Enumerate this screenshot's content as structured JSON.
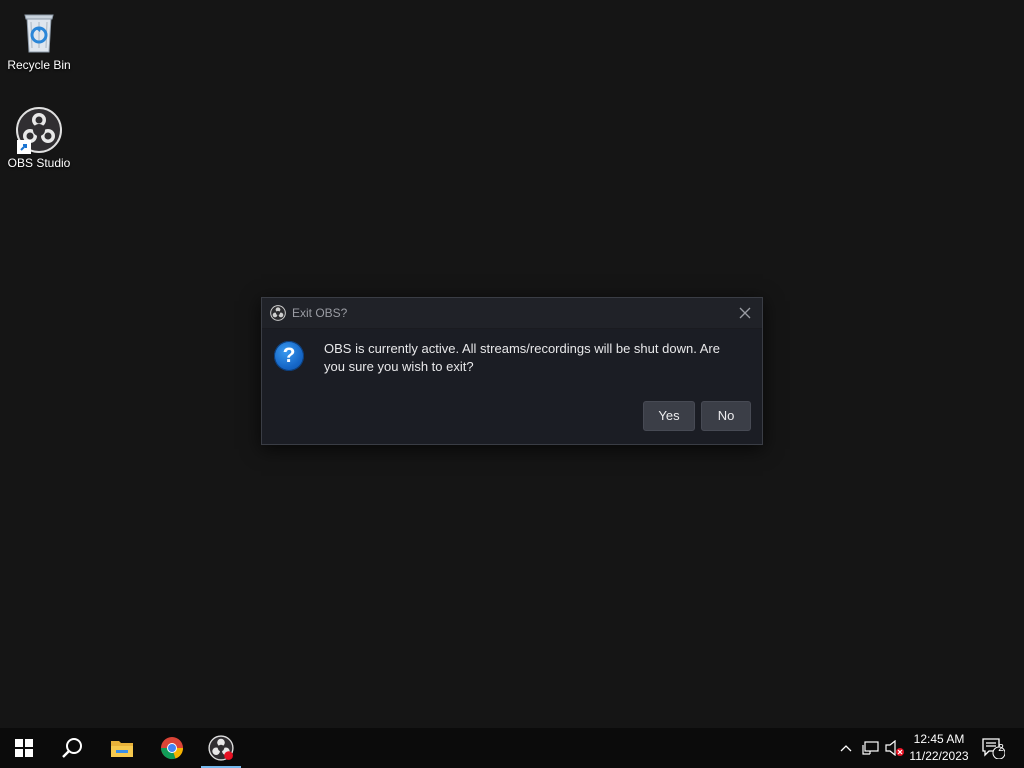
{
  "desktop": {
    "icons": [
      {
        "label": "Recycle Bin",
        "icon": "recycle-bin-icon"
      },
      {
        "label": "OBS Studio",
        "icon": "obs-studio-icon"
      }
    ]
  },
  "dialog": {
    "title": "Exit OBS?",
    "message": "OBS is currently active. All streams/recordings will be shut down. Are you sure you wish to exit?",
    "yes_label": "Yes",
    "no_label": "No",
    "icon": "question-icon"
  },
  "taskbar": {
    "items": [
      {
        "name": "start",
        "icon": "windows-start-icon"
      },
      {
        "name": "search",
        "icon": "search-icon"
      },
      {
        "name": "file-explorer",
        "icon": "folder-icon"
      },
      {
        "name": "chrome",
        "icon": "chrome-icon"
      },
      {
        "name": "obs",
        "icon": "obs-studio-icon",
        "active": true
      }
    ],
    "tray": {
      "time": "12:45 AM",
      "date": "11/22/2023",
      "notification_count": "2"
    }
  },
  "colors": {
    "desktop_bg": "#151515",
    "dialog_bg": "#1b1d24",
    "accent": "#76b9ed",
    "question_blue": "#1667c7"
  }
}
